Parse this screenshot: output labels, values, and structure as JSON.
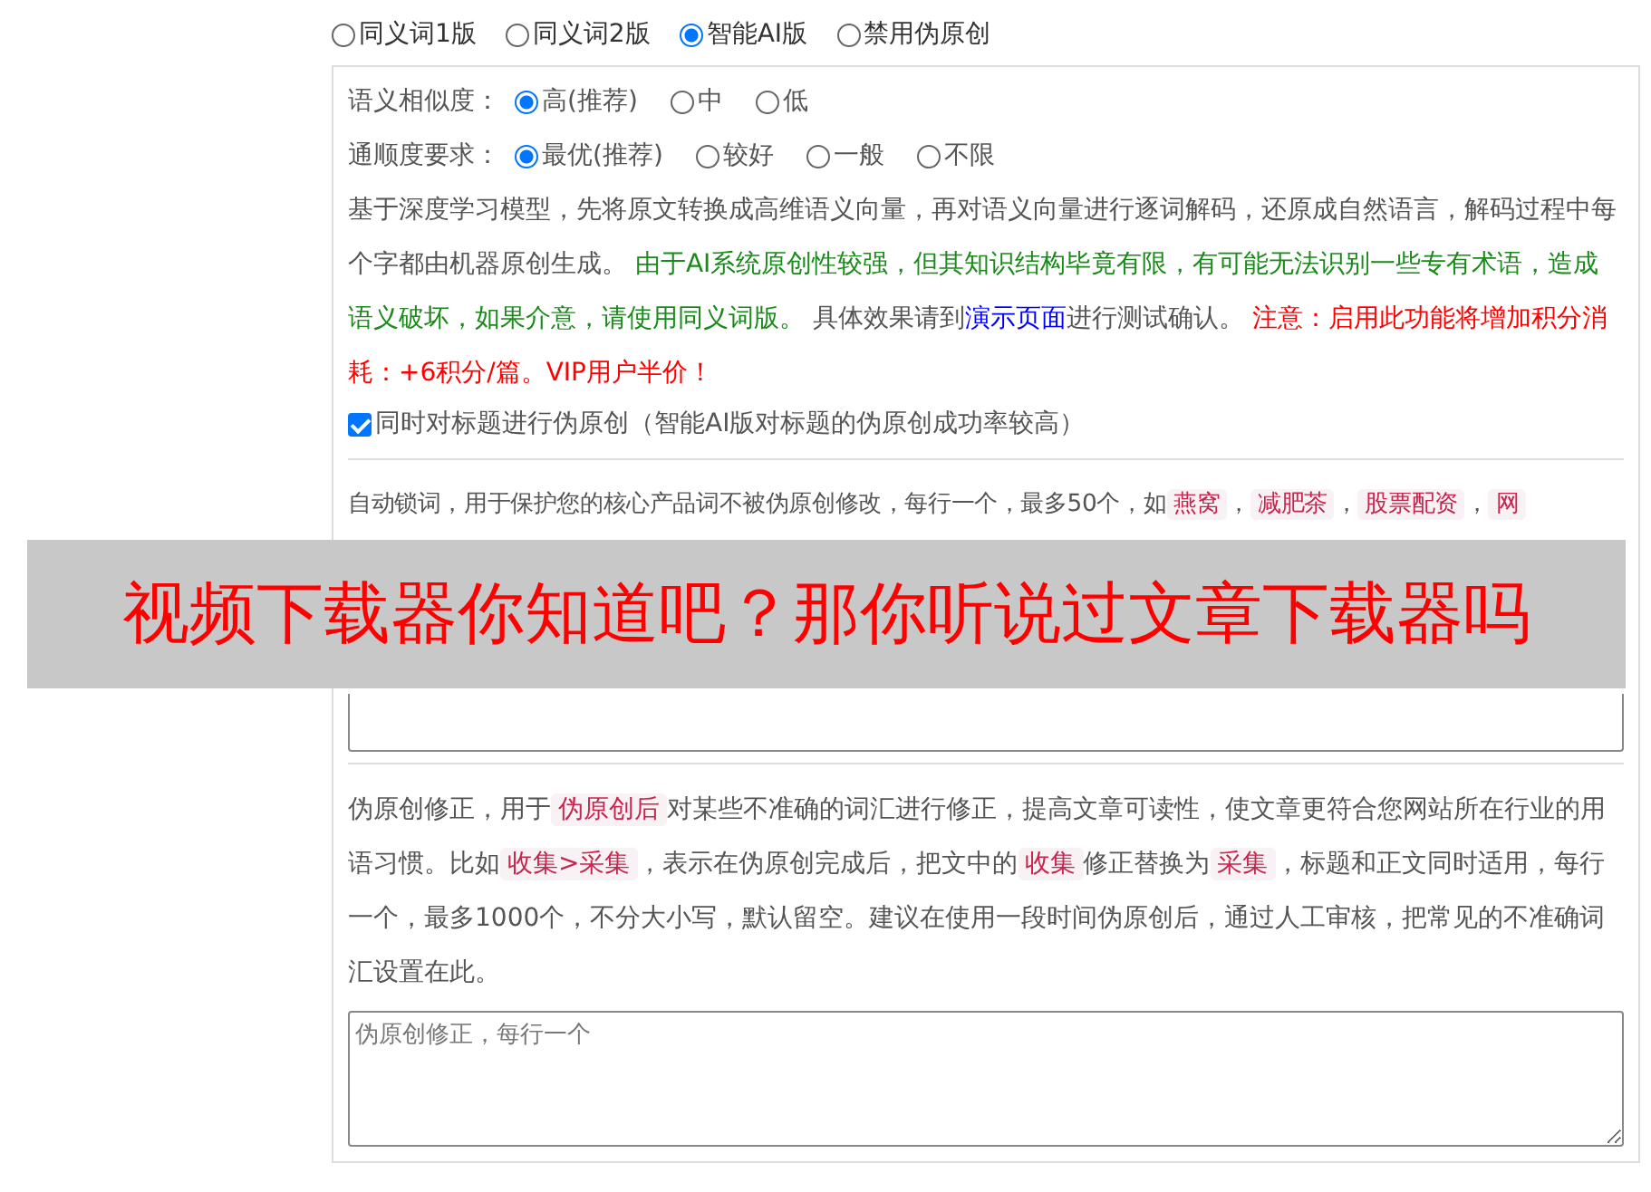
{
  "mode_options": [
    {
      "label": "同义词1版",
      "selected": false
    },
    {
      "label": "同义词2版",
      "selected": false
    },
    {
      "label": "智能AI版",
      "selected": true
    },
    {
      "label": "禁用伪原创",
      "selected": false
    }
  ],
  "ai_settings": {
    "similarity": {
      "label": "语义相似度：",
      "options": [
        {
          "label": "高(推荐)",
          "selected": true
        },
        {
          "label": "中",
          "selected": false
        },
        {
          "label": "低",
          "selected": false
        }
      ]
    },
    "fluency": {
      "label": "通顺度要求：",
      "options": [
        {
          "label": "最优(推荐)",
          "selected": true
        },
        {
          "label": "较好",
          "selected": false
        },
        {
          "label": "一般",
          "selected": false
        },
        {
          "label": "不限",
          "selected": false
        }
      ]
    },
    "description": [
      {
        "kind": "plain",
        "text": "基于深度学习模型，先将原文转换成高维语义向量，再对语义向量进行逐词解码，还原成自然语言，解码过程中每个字都由机器原创生成。 "
      },
      {
        "kind": "green",
        "text": "由于AI系统原创性较强，但其知识结构毕竟有限，有可能无法识别一些专有术语，造成语义破坏，如果介意，请使用同义词版。"
      },
      {
        "kind": "plain",
        "text": " 具体效果请到"
      },
      {
        "kind": "link",
        "text": "演示页面"
      },
      {
        "kind": "plain",
        "text": "进行测试确认。 "
      },
      {
        "kind": "red",
        "text": "注意：启用此功能将增加积分消耗：+6积分/篇。VIP用户半价！"
      }
    ],
    "title_checkbox": {
      "label": "同时对标题进行伪原创（智能AI版对标题的伪原创成功率较高）",
      "checked": true
    }
  },
  "lock_words": {
    "description": [
      {
        "kind": "plain",
        "text": "自动锁词，用于保护您的核心产品词不被伪原创修改，每行一个，最多50个，如"
      },
      {
        "kind": "tag",
        "text": "燕窝"
      },
      {
        "kind": "plain",
        "text": "，"
      },
      {
        "kind": "tag",
        "text": "减肥茶"
      },
      {
        "kind": "plain",
        "text": "，"
      },
      {
        "kind": "tag",
        "text": "股票配资"
      },
      {
        "kind": "plain",
        "text": "，"
      },
      {
        "kind": "tag",
        "text": "网"
      }
    ]
  },
  "overlay_banner": {
    "text": "视频下载器你知道吧？那你听说过文章下载器吗"
  },
  "corrections": {
    "description": [
      {
        "kind": "plain",
        "text": "伪原创修正，用于"
      },
      {
        "kind": "tag",
        "text": "伪原创后"
      },
      {
        "kind": "plain",
        "text": "对某些不准确的词汇进行修正，提高文章可读性，使文章更符合您网站所在行业的用语习惯。比如"
      },
      {
        "kind": "tag",
        "text": "收集>采集"
      },
      {
        "kind": "plain",
        "text": "，表示在伪原创完成后，把文中的"
      },
      {
        "kind": "tag",
        "text": "收集"
      },
      {
        "kind": "plain",
        "text": "修正替换为"
      },
      {
        "kind": "tag",
        "text": "采集"
      },
      {
        "kind": "plain",
        "text": "，标题和正文同时适用，每行一个，最多1000个，不分大小写，默认留空。建议在使用一段时间伪原创后，通过人工审核，把常见的不准确词汇设置在此。"
      }
    ],
    "placeholder": "伪原创修正，每行一个"
  }
}
